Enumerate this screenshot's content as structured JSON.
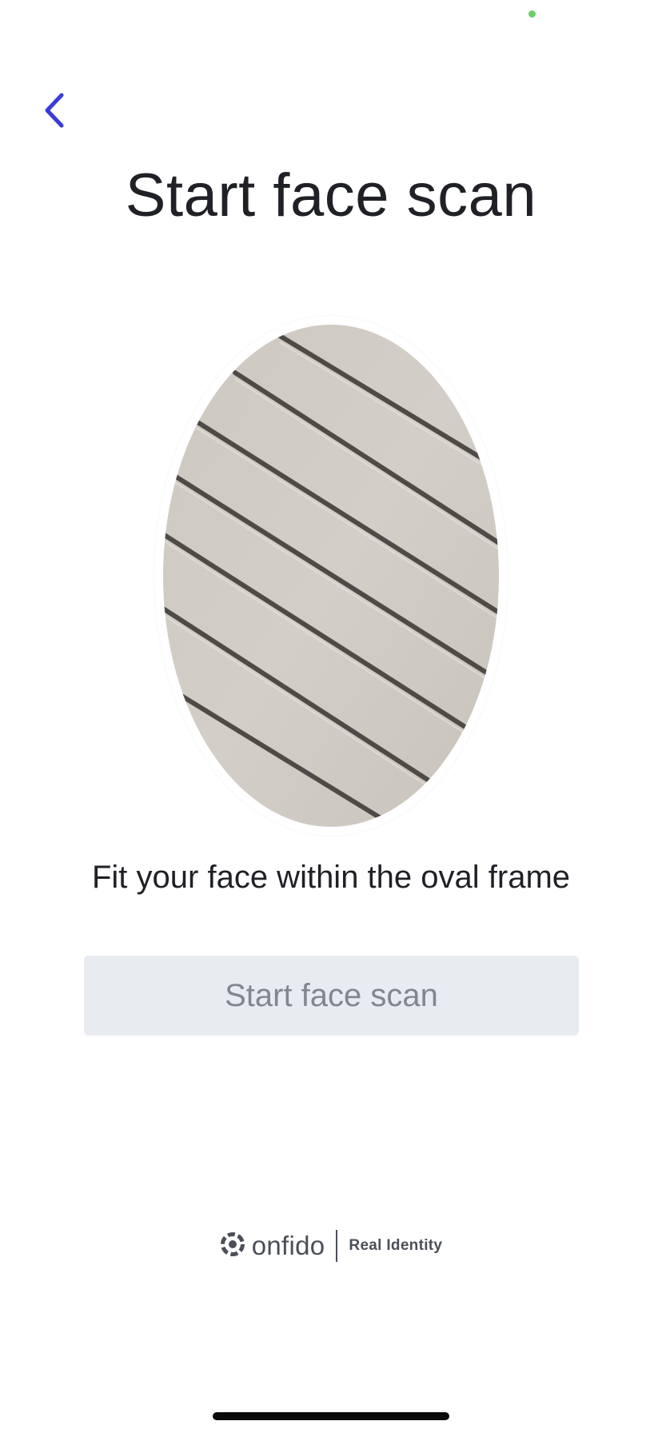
{
  "header": {
    "back_icon": "chevron-left-icon",
    "title": "Start face scan"
  },
  "capture": {
    "hint": "Fit your face within the oval frame"
  },
  "actions": {
    "start_label": "Start face scan",
    "start_enabled": false
  },
  "footer": {
    "brand_logo_icon": "onfido-logo-icon",
    "brand_name": "onfido",
    "tagline": "Real Identity"
  },
  "colors": {
    "accent": "#3b3bd8",
    "status_dot": "#6bcf6b",
    "title_text": "#1f2126",
    "button_bg_disabled": "#e8ebef",
    "button_text_disabled": "#82868e"
  }
}
